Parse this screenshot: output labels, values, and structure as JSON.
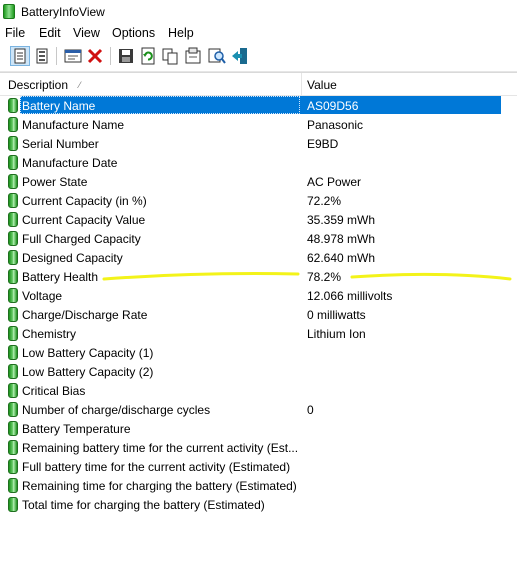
{
  "window": {
    "title": "BatteryInfoView"
  },
  "menu": [
    "File",
    "Edit",
    "View",
    "Options",
    "Help"
  ],
  "toolbar": [
    {
      "icon": "view-details-icon"
    },
    {
      "icon": "view-report-icon"
    },
    {
      "icon": "properties-icon"
    },
    {
      "icon": "delete-icon"
    },
    {
      "icon": "save-icon"
    },
    {
      "icon": "refresh-icon"
    },
    {
      "icon": "copy-icon"
    },
    {
      "icon": "options-icon"
    },
    {
      "icon": "find-icon"
    },
    {
      "icon": "exit-icon"
    }
  ],
  "columns": {
    "description": "Description",
    "value": "Value"
  },
  "rows": [
    {
      "description": "Battery Name",
      "value": "AS09D56",
      "selected": true
    },
    {
      "description": "Manufacture Name",
      "value": "Panasonic"
    },
    {
      "description": "Serial Number",
      "value": "E9BD"
    },
    {
      "description": "Manufacture Date",
      "value": ""
    },
    {
      "description": "Power State",
      "value": "AC Power"
    },
    {
      "description": "Current Capacity (in %)",
      "value": "72.2%"
    },
    {
      "description": "Current Capacity Value",
      "value": "35.359 mWh"
    },
    {
      "description": "Full Charged Capacity",
      "value": "48.978 mWh"
    },
    {
      "description": "Designed Capacity",
      "value": "62.640 mWh"
    },
    {
      "description": "Battery Health",
      "value": "78.2%",
      "highlighted": true
    },
    {
      "description": "Voltage",
      "value": "12.066 millivolts"
    },
    {
      "description": "Charge/Discharge Rate",
      "value": "0 milliwatts"
    },
    {
      "description": "Chemistry",
      "value": "Lithium Ion"
    },
    {
      "description": "Low Battery Capacity (1)",
      "value": ""
    },
    {
      "description": "Low Battery Capacity (2)",
      "value": ""
    },
    {
      "description": "Critical Bias",
      "value": ""
    },
    {
      "description": "Number of charge/discharge cycles",
      "value": "0"
    },
    {
      "description": "Battery Temperature",
      "value": ""
    },
    {
      "description": "Remaining battery time for the current activity (Est...",
      "value": ""
    },
    {
      "description": "Full battery time for the current activity (Estimated)",
      "value": ""
    },
    {
      "description": "Remaining time for charging the battery (Estimated)",
      "value": ""
    },
    {
      "description": "Total  time for charging the battery (Estimated)",
      "value": ""
    }
  ],
  "colors": {
    "selection": "#0078d7",
    "highlighter": "#f2f200",
    "battery": "#1a8f1a"
  }
}
